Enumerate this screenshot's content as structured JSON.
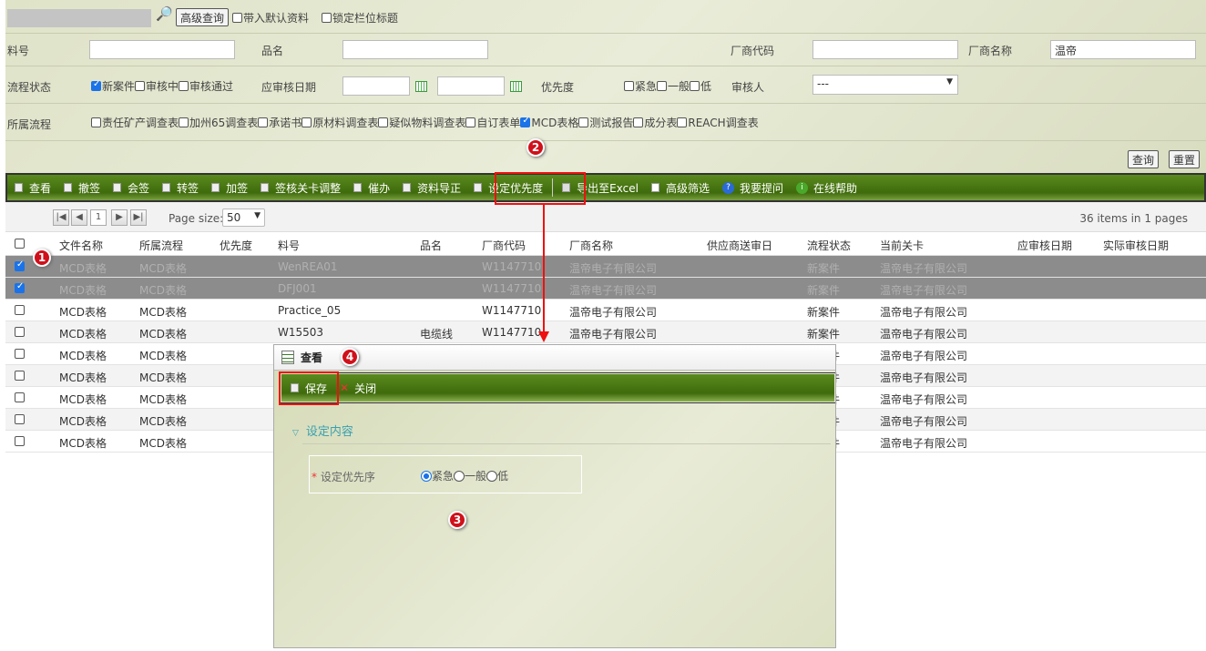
{
  "search": {
    "advanced_query": "高级查询",
    "bring_default": "带入默认资料",
    "lock_headers": "锁定栏位标题"
  },
  "filters": {
    "part_no_label": "料号",
    "part_no_value": "",
    "product_name_label": "品名",
    "product_name_value": "",
    "vendor_code_label": "厂商代码",
    "vendor_code_value": "",
    "vendor_name_label": "厂商名称",
    "vendor_name_value": "温帝",
    "status_label": "流程状态",
    "status_options": [
      {
        "label": "新案件",
        "checked": true
      },
      {
        "label": "审核中",
        "checked": false
      },
      {
        "label": "审核通过",
        "checked": false
      }
    ],
    "due_date_label": "应审核日期",
    "due_from": "",
    "due_to": "",
    "priority_label": "优先度",
    "priority_options": [
      {
        "label": "紧急",
        "checked": false
      },
      {
        "label": "一般",
        "checked": false
      },
      {
        "label": "低",
        "checked": false
      }
    ],
    "reviewer_label": "审核人",
    "reviewer_value": "---",
    "flow_label": "所属流程",
    "flow_options": [
      {
        "label": "责任矿产调查表",
        "checked": false
      },
      {
        "label": "加州65调查表",
        "checked": false
      },
      {
        "label": "承诺书",
        "checked": false
      },
      {
        "label": "原材料调查表",
        "checked": false
      },
      {
        "label": "疑似物料调查表",
        "checked": false
      },
      {
        "label": "自订表单",
        "checked": false
      },
      {
        "label": "MCD表格",
        "checked": true
      },
      {
        "label": "测试报告",
        "checked": false
      },
      {
        "label": "成分表",
        "checked": false
      },
      {
        "label": "REACH调查表",
        "checked": false
      }
    ],
    "query_button": "查询",
    "reset_button": "重置"
  },
  "toolbar": [
    "查看",
    "撤签",
    "会签",
    "转签",
    "加签",
    "签核关卡调整",
    "催办",
    "资料导正",
    "设定优先度",
    "导出至Excel",
    "高级筛选",
    "我要提问",
    "在线帮助"
  ],
  "pager": {
    "page": "1",
    "page_size_label": "Page size:",
    "page_size": "50",
    "summary": "36 items in 1 pages"
  },
  "table": {
    "columns": [
      "文件名称",
      "所属流程",
      "优先度",
      "料号",
      "品名",
      "厂商代码",
      "厂商名称",
      "供应商送审日",
      "流程状态",
      "当前关卡",
      "应审核日期",
      "实际审核日期"
    ],
    "rows": [
      {
        "checked": true,
        "cells": [
          "MCD表格",
          "MCD表格",
          "",
          "WenREA01",
          "",
          "W1147710",
          "温帝电子有限公司",
          "",
          "新案件",
          "温帝电子有限公司",
          "",
          ""
        ]
      },
      {
        "checked": true,
        "cells": [
          "MCD表格",
          "MCD表格",
          "",
          "DFJ001",
          "",
          "W1147710",
          "温帝电子有限公司",
          "",
          "新案件",
          "温帝电子有限公司",
          "",
          ""
        ]
      },
      {
        "checked": false,
        "cells": [
          "MCD表格",
          "MCD表格",
          "",
          "Practice_05",
          "",
          "W1147710",
          "温帝电子有限公司",
          "",
          "新案件",
          "温帝电子有限公司",
          "",
          ""
        ]
      },
      {
        "checked": false,
        "cells": [
          "MCD表格",
          "MCD表格",
          "",
          "W15503",
          "电缆线",
          "W1147710",
          "温帝电子有限公司",
          "",
          "新案件",
          "温帝电子有限公司",
          "",
          ""
        ]
      },
      {
        "checked": false,
        "cells": [
          "MCD表格",
          "MCD表格",
          "",
          "",
          "",
          "",
          "",
          "",
          "新案件",
          "温帝电子有限公司",
          "",
          ""
        ]
      },
      {
        "checked": false,
        "cells": [
          "MCD表格",
          "MCD表格",
          "",
          "",
          "",
          "",
          "",
          "",
          "新案件",
          "温帝电子有限公司",
          "",
          ""
        ]
      },
      {
        "checked": false,
        "cells": [
          "MCD表格",
          "MCD表格",
          "",
          "",
          "",
          "",
          "",
          "",
          "新案件",
          "温帝电子有限公司",
          "",
          ""
        ]
      },
      {
        "checked": false,
        "cells": [
          "MCD表格",
          "MCD表格",
          "",
          "",
          "",
          "",
          "",
          "",
          "新案件",
          "温帝电子有限公司",
          "",
          ""
        ]
      },
      {
        "checked": false,
        "cells": [
          "MCD表格",
          "MCD表格",
          "",
          "",
          "",
          "",
          "",
          "",
          "新案件",
          "温帝电子有限公司",
          "",
          ""
        ]
      }
    ]
  },
  "dialog": {
    "title": "查看",
    "save": "保存",
    "close": "关闭",
    "section": "设定内容",
    "field_label": "设定优先序",
    "options": [
      {
        "label": "紧急",
        "selected": true
      },
      {
        "label": "一般",
        "selected": false
      },
      {
        "label": "低",
        "selected": false
      }
    ]
  },
  "badges": [
    "1",
    "2",
    "3",
    "4"
  ],
  "colors": {
    "toolbar_green": "#4a7a12",
    "highlight_red": "#e11111",
    "section_teal": "#3aa0b0"
  }
}
